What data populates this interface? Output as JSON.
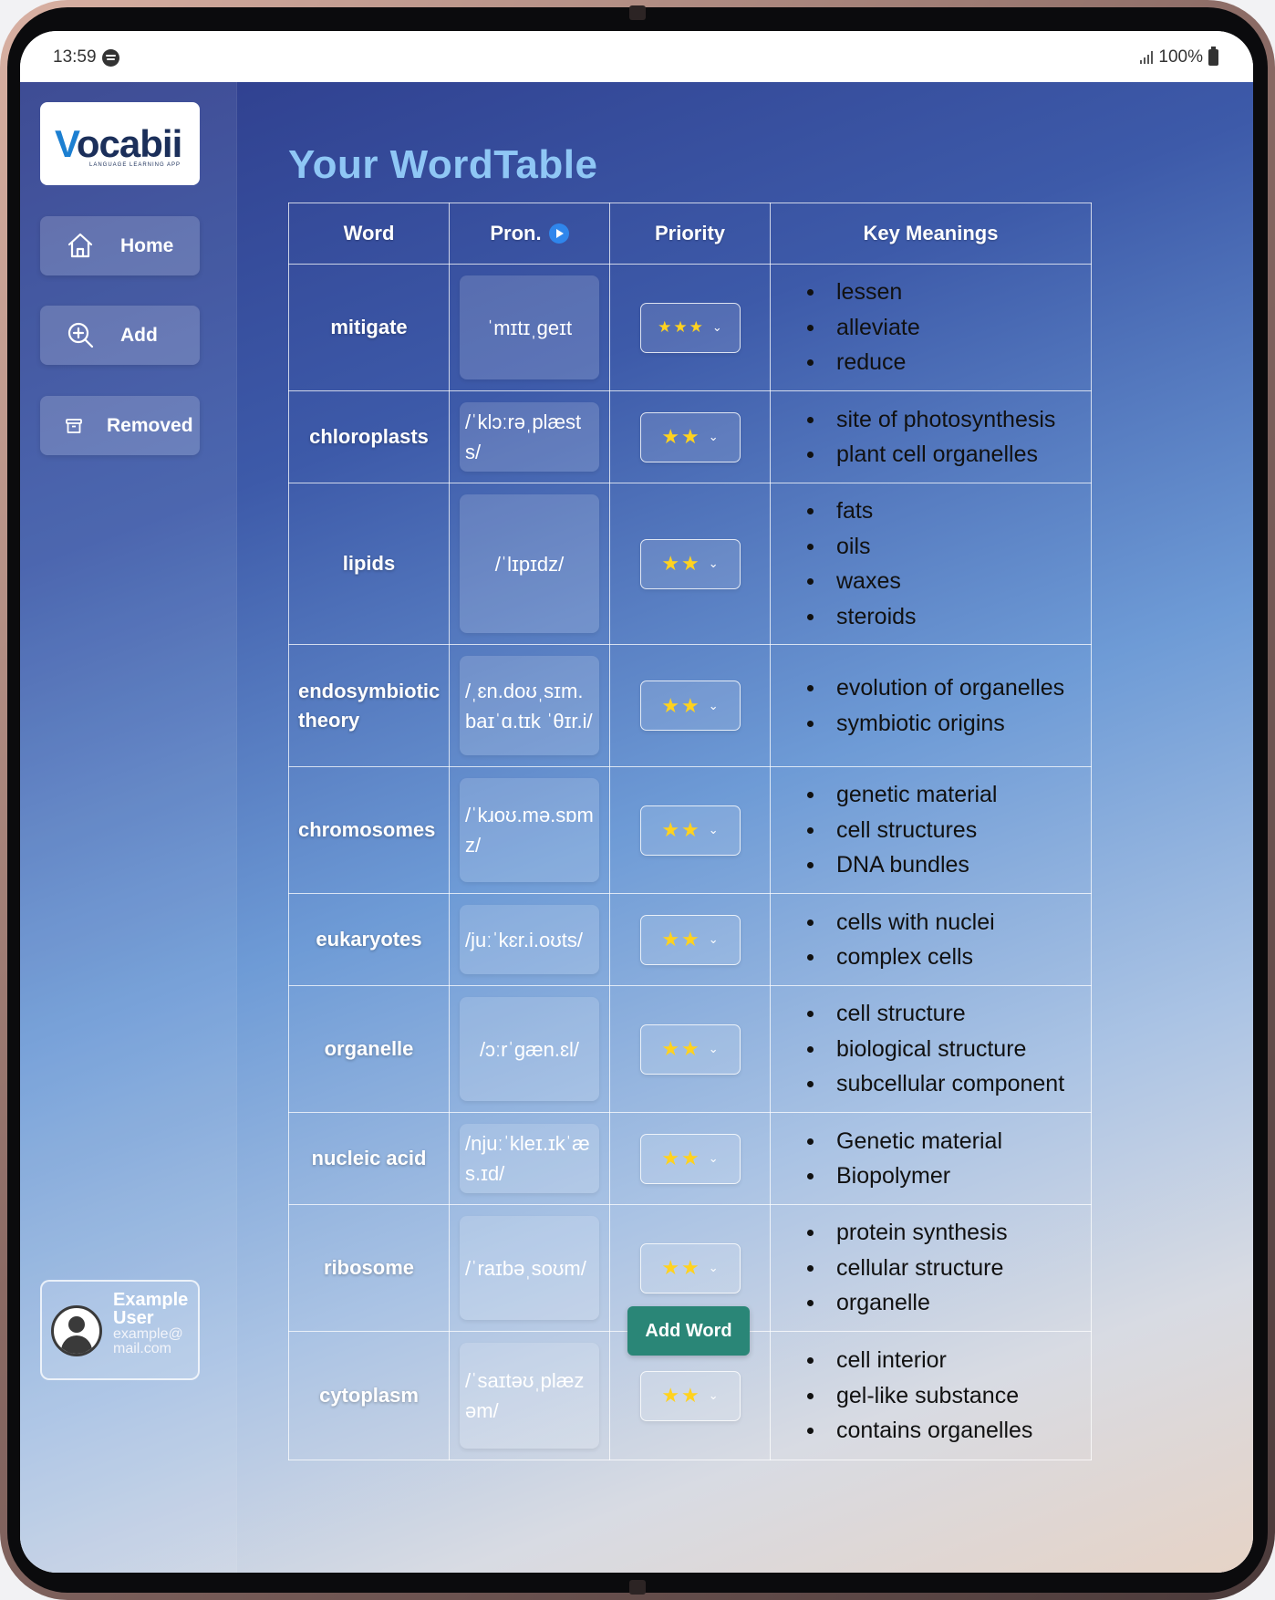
{
  "status_bar": {
    "time": "13:59",
    "battery": "100%"
  },
  "sidebar": {
    "logo_text": "vocabii",
    "logo_tagline": "LANGUAGE LEARNING APP",
    "nav": [
      {
        "label": "Home",
        "icon": "home-icon"
      },
      {
        "label": "Add",
        "icon": "zoom-plus-icon"
      },
      {
        "label": "Removed",
        "icon": "archive-icon"
      }
    ],
    "user": {
      "name": "Example User",
      "email": "example@mail.com",
      "icon": "user-avatar-icon"
    }
  },
  "main": {
    "title": "Your WordTable",
    "columns": [
      "Word",
      "Pron.",
      "Priority",
      "Key Meanings"
    ],
    "pron_play_icon": "play-circle-icon",
    "add_word_label": "Add Word"
  },
  "rows": [
    {
      "word": "mitigate",
      "pron": "ˈmɪtɪˌɡeɪt",
      "stars": 3,
      "stars_text": "★★★",
      "meanings": [
        "lessen",
        "alleviate",
        "reduce"
      ]
    },
    {
      "word": "chloroplasts",
      "pron": "/ˈklɔːrəˌplæsts/",
      "stars": 2,
      "stars_text": "★★",
      "meanings": [
        "site of photosynthesis",
        "plant cell organelles"
      ]
    },
    {
      "word": "lipids",
      "pron": "/ˈlɪpɪdz/",
      "stars": 2,
      "stars_text": "★★",
      "meanings": [
        "fats",
        "oils",
        "waxes",
        "steroids"
      ]
    },
    {
      "word": "endosymbiotic theory",
      "pron": "/ˌɛn.doʊˌsɪm.baɪˈɑ.tɪk ˈθɪr.i/",
      "stars": 2,
      "stars_text": "★★",
      "meanings": [
        "evolution of organelles",
        "symbiotic origins"
      ]
    },
    {
      "word": "chromosomes",
      "pron": "/ˈkɹoʊ.mə.sɒmz/",
      "stars": 2,
      "stars_text": "★★",
      "meanings": [
        "genetic material",
        "cell structures",
        "DNA bundles"
      ]
    },
    {
      "word": "eukaryotes",
      "pron": "/juːˈkɛr.i.oʊts/",
      "stars": 2,
      "stars_text": "★★",
      "meanings": [
        "cells with nuclei",
        "complex cells"
      ]
    },
    {
      "word": "organelle",
      "pron": "/ɔːrˈɡæn.ɛl/",
      "stars": 2,
      "stars_text": "★★",
      "meanings": [
        "cell structure",
        "biological structure",
        "subcellular component"
      ]
    },
    {
      "word": "nucleic acid",
      "pron": "/njuːˈkleɪ.ɪkˈæs.ɪd/",
      "stars": 2,
      "stars_text": "★★",
      "meanings": [
        "Genetic material",
        "Biopolymer"
      ]
    },
    {
      "word": "ribosome",
      "pron": "/ˈraɪbəˌsoʊm/",
      "stars": 2,
      "stars_text": "★★",
      "meanings": [
        "protein synthesis",
        "cellular structure",
        "organelle"
      ]
    },
    {
      "word": "cytoplasm",
      "pron": "/ˈsaɪtəʊˌplæzəm/",
      "stars": 2,
      "stars_text": "★★",
      "meanings": [
        "cell interior",
        "gel-like substance",
        "contains organelles"
      ]
    }
  ],
  "colors": {
    "title": "#8fc7f5",
    "star": "#ffd21f",
    "add_word_button": "#2a8677",
    "play_icon": "#2f86ec"
  }
}
